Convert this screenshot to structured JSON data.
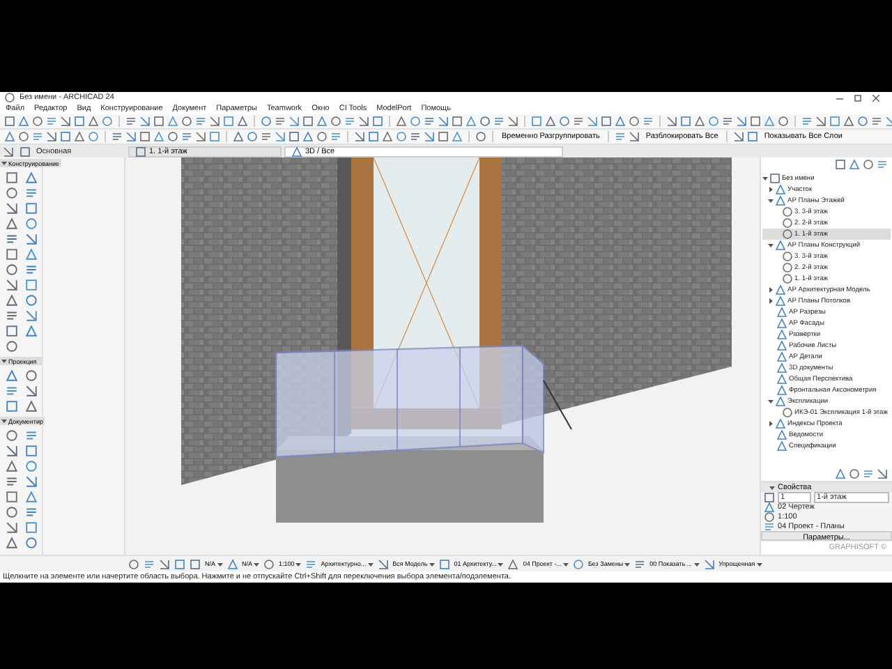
{
  "window": {
    "title": "Без имени - ARCHICAD 24"
  },
  "menu": [
    "Файл",
    "Редактор",
    "Вид",
    "Конструирование",
    "Документ",
    "Параметры",
    "Teamwork",
    "Окно",
    "CI Tools",
    "ModelPort",
    "Помощь"
  ],
  "toolbar": {
    "buttons": [
      "Временно Разгруппировать",
      "Разблокировать Все",
      "Показывать Все Слои"
    ]
  },
  "tabs": [
    {
      "label": "1. 1-й этаж",
      "selected": false
    },
    {
      "label": "3D / Все",
      "selected": true
    }
  ],
  "info_box": {
    "label": "Основная"
  },
  "toolbox": {
    "sections": [
      {
        "title": "Конструирование",
        "expanded": true
      },
      {
        "title": "Проекция",
        "expanded": true
      },
      {
        "title": "Документир",
        "expanded": true
      }
    ]
  },
  "navigator": {
    "tree": [
      {
        "label": "Без имени",
        "expanded": true,
        "selected": false,
        "children": [
          {
            "label": "Участок",
            "expanded": false,
            "selected": false
          },
          {
            "label": "АР Планы Этажей",
            "expanded": true,
            "selected": false,
            "children": [
              {
                "label": "3. 3-й этаж",
                "selected": false
              },
              {
                "label": "2. 2-й этаж",
                "selected": false
              },
              {
                "label": "1. 1-й этаж",
                "selected": true
              }
            ]
          },
          {
            "label": "АР Планы Конструкций",
            "expanded": true,
            "selected": false,
            "children": [
              {
                "label": "3. 3-й этаж",
                "selected": false
              },
              {
                "label": "2. 2-й этаж",
                "selected": false
              },
              {
                "label": "1. 1-й этаж",
                "selected": false
              }
            ]
          },
          {
            "label": "АР Архитектурная Модель",
            "expanded": false,
            "selected": false
          },
          {
            "label": "АР Планы Потолков",
            "expanded": false,
            "selected": false
          },
          {
            "label": "АР Разрезы",
            "selected": false
          },
          {
            "label": "АР Фасады",
            "selected": false
          },
          {
            "label": "Развертки",
            "selected": false
          },
          {
            "label": "Рабочие Листы",
            "selected": false
          },
          {
            "label": "АР Детали",
            "selected": false
          },
          {
            "label": "3D документы",
            "selected": false
          },
          {
            "label": "Общая Перспектива",
            "selected": false
          },
          {
            "label": "Фронтальная Аксонометрия",
            "selected": false
          },
          {
            "label": "Экспликации",
            "expanded": true,
            "selected": false,
            "children": [
              {
                "label": "ИКЭ-01 Экспликация 1-й этаж",
                "selected": false
              }
            ]
          },
          {
            "label": "Индексы Проекта",
            "expanded": false,
            "selected": false
          },
          {
            "label": "Ведомости",
            "selected": false
          },
          {
            "label": "Спецификации",
            "selected": false
          }
        ]
      }
    ]
  },
  "properties": {
    "title": "Свойства",
    "expanded": true,
    "id": "1",
    "name": "1-й этаж",
    "rows": [
      "02 Чертеж",
      "1:100",
      "04 Проект - Планы"
    ],
    "button": "Параметры..."
  },
  "brand": "GRAPHISOFT ©",
  "view_controls": [
    "N/A",
    "N/A",
    "1:100",
    "Архитектурно...",
    "Вся Модель",
    "01 Архитекту...",
    "04 Проект -...",
    "Без Замены",
    "00 Показать ...",
    "Упрощенная"
  ],
  "status": "Щелкните на элементе или начертите область выбора. Нажмите и не отпускайте Ctrl+Shift для переключения выбора элемента/подэлемента."
}
